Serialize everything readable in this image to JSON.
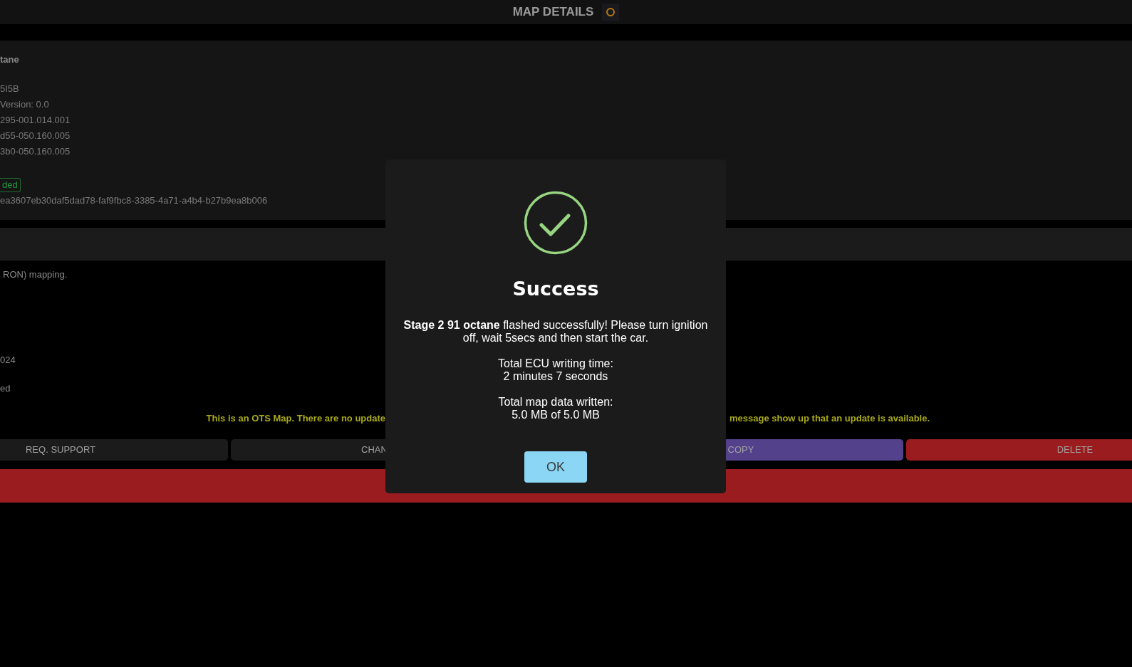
{
  "header": {
    "title": "MAP DETAILS"
  },
  "details": {
    "name": "tane",
    "lines": [
      "5I5B",
      "Version: 0.0",
      "295-001.014.001",
      "d55-050.160.005",
      "3b0-050.160.005"
    ],
    "badge": "ded",
    "id": "ea3607eb30daf5dad78-faf9fbc8-3385-4a71-a4b4-b27b9ea8b006"
  },
  "description": {
    "lines": [
      "RON) mapping.",
      "024",
      "ed"
    ],
    "notice_left": "This is an OTS Map. There are no update",
    "notice_right": "message show up that an update is available."
  },
  "actions": [
    {
      "label": "REQ. SUPPORT",
      "kind": "neutral"
    },
    {
      "label": "CHAN",
      "kind": "neutral"
    },
    {
      "label": "COPY",
      "kind": "copy"
    },
    {
      "label": "DELETE",
      "kind": "danger"
    }
  ],
  "dialog": {
    "title": "Success",
    "message": "**Stage 2 91 octane** flashed successfully! Please turn ignition off, wait 5secs and then start the car.",
    "stats": [
      {
        "label": "Total ECU writing time:",
        "value": "2 minutes 7 seconds"
      },
      {
        "label": "Total map data written:",
        "value": "5.0 MB of 5.0 MB"
      }
    ],
    "button": "OK"
  }
}
